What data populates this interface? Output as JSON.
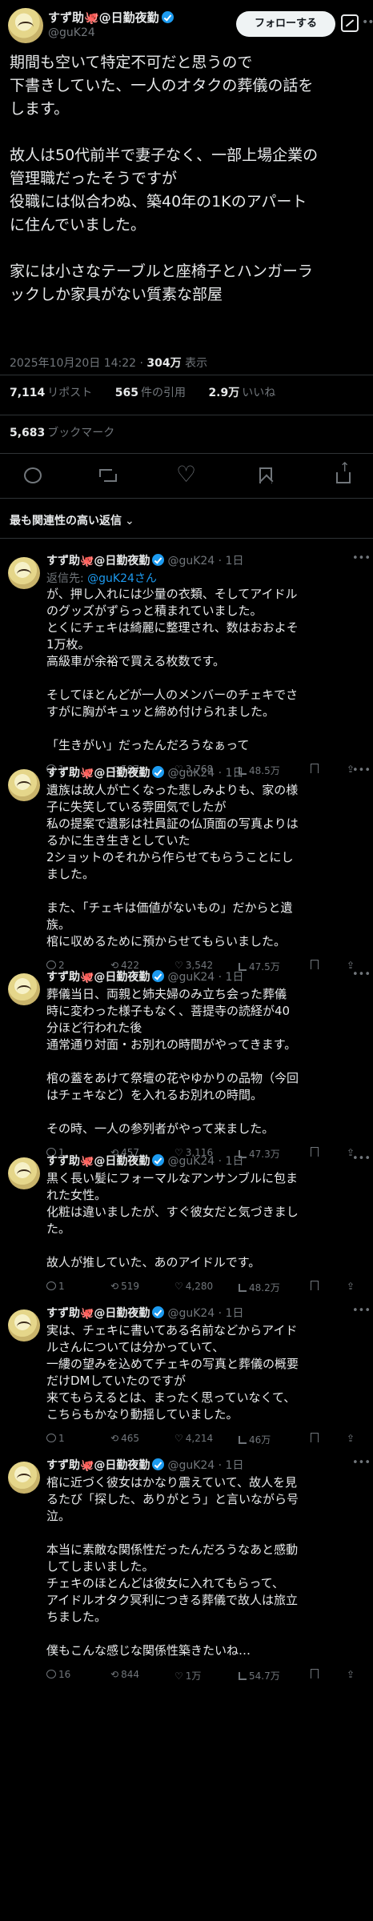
{
  "post": {
    "display_name": "すず助🐙@日勤夜勤",
    "handle": "@guK24",
    "follow_label": "フォローする",
    "more_label": "•••",
    "body_lines": [
      "期間も空いて特定不可だと思うので",
      "下書きしていた、一人のオタクの葬儀の話を",
      "します。",
      "",
      "故人は50代前半で妻子なく、一部上場企業の",
      "管理職だったそうですが",
      "役職には似合わぬ、築40年の1Kのアパート",
      "に住んでいました。",
      "",
      "家には小さなテーブルと座椅子とハンガーラ",
      "ックしか家具がない質素な部屋"
    ],
    "timestamp": "2025年10月20日 14:22 · ",
    "views_count": "304万",
    "views_label": " 表示",
    "reposts_count": "7,114",
    "reposts_label": "リポスト",
    "quotes_count": "565",
    "quotes_label": "件の引用",
    "likes_count": "2.9万",
    "likes_label": "いいね",
    "bookmarks_count": "5,683",
    "bookmarks_label": "ブックマーク"
  },
  "sort_label": "最も関連性の高い返信",
  "replies": [
    {
      "name": "すず助🐙@日勤夜勤",
      "handle": "@guK24 · 1日",
      "reply_to_prefix": "返信先: ",
      "reply_to_handle": "@guK24さん",
      "lines": [
        "が、押し入れには少量の衣類、そしてアイドル",
        "のグッズがずらっと積まれていました。",
        "とくにチェキは綺麗に整理され、数はおおよそ",
        "1万枚。",
        "高級車が余裕で買える枚数です。",
        "",
        "そしてほとんどが一人のメンバーのチェキでさ",
        "すがに胸がキュッと締め付けられました。",
        "",
        "「生きがい」だったんだろうなぁって"
      ],
      "replies": "1",
      "reposts": "507",
      "likes": "3,768",
      "views": "48.5万"
    },
    {
      "name": "すず助🐙@日勤夜勤",
      "handle": "@guK24 · 1日",
      "lines": [
        "遺族は故人が亡くなった悲しみよりも、家の様",
        "子に失笑している雰囲気でしたが",
        "私の提案で遺影は社員証の仏頂面の写真よりは",
        "るかに生き生きとしていた",
        "2ショットのそれから作らせてもらうことにし",
        "ました。",
        "",
        "また、「チェキは価値がないもの」だからと遺",
        "族。",
        "棺に収めるために預からせてもらいました。"
      ],
      "replies": "2",
      "reposts": "422",
      "likes": "3,542",
      "views": "47.5万"
    },
    {
      "name": "すず助🐙@日勤夜勤",
      "handle": "@guK24 · 1日",
      "lines": [
        "葬儀当日、両親と姉夫婦のみ立ち会った葬儀",
        "時に変わった様子もなく、菩提寺の読経が40",
        "分ほど行われた後",
        "通常通り対面・お別れの時間がやってきます。",
        "",
        "棺の蓋をあけて祭壇の花やゆかりの品物（今回",
        "はチェキなど）を入れるお別れの時間。",
        "",
        "その時、一人の参列者がやって来ました。"
      ],
      "replies": "1",
      "reposts": "457",
      "likes": "3,116",
      "views": "47.3万"
    },
    {
      "name": "すず助🐙@日勤夜勤",
      "handle": "@guK24 · 1日",
      "lines": [
        "黒く長い髪にフォーマルなアンサンブルに包ま",
        "れた女性。",
        "化粧は違いましたが、すぐ彼女だと気づきまし",
        "た。",
        "",
        "故人が推していた、あのアイドルです。"
      ],
      "replies": "1",
      "reposts": "519",
      "likes": "4,280",
      "views": "48.2万"
    },
    {
      "name": "すず助🐙@日勤夜勤",
      "handle": "@guK24 · 1日",
      "lines": [
        "実は、チェキに書いてある名前などからアイド",
        "ルさんについては分かっていて、",
        "一縷の望みを込めてチェキの写真と葬儀の概要",
        "だけDMしていたのですが",
        "来てもらえるとは、まったく思っていなくて、",
        "こちらもかなり動揺していました。"
      ],
      "replies": "1",
      "reposts": "465",
      "likes": "4,214",
      "views": "46万"
    },
    {
      "name": "すず助🐙@日勤夜勤",
      "handle": "@guK24 · 1日",
      "lines": [
        "棺に近づく彼女はかなり震えていて、故人を見",
        "るたび「探した、ありがとう」と言いながら号",
        "泣。",
        "",
        "本当に素敵な関係性だったんだろうなあと感動",
        "してしまいました。",
        "チェキのほとんどは彼女に入れてもらって、",
        "アイドルオタク冥利につきる葬儀で故人は旅立",
        "ちました。",
        "",
        "僕もこんな感じな関係性築きたいね…"
      ],
      "replies": "16",
      "reposts": "844",
      "likes": "1万",
      "views": "54.7万"
    }
  ]
}
